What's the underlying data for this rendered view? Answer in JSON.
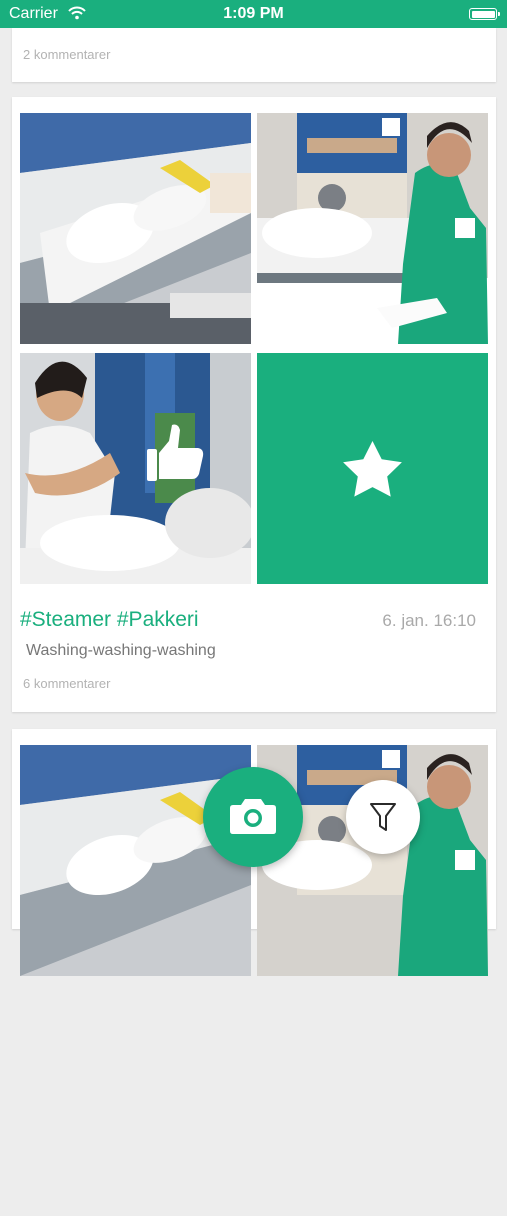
{
  "status_bar": {
    "carrier": "Carrier",
    "time": "1:09 PM"
  },
  "feed": {
    "top_card": {
      "comments": "2 kommentarer"
    },
    "post": {
      "tags": "#Steamer #Pakkeri",
      "date": "6. jan. 16:10",
      "description": "Washing-washing-washing",
      "comments": "6 kommentarer"
    }
  },
  "colors": {
    "brand": "#1aaf7e",
    "card": "#ffffff",
    "background": "#ededed"
  },
  "icons": [
    "wifi-icon",
    "battery-icon",
    "star-icon",
    "thumbs-up-icon",
    "camera-icon",
    "filter-icon"
  ]
}
